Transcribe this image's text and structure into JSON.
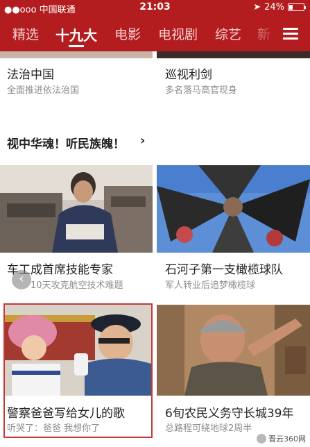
{
  "status_bar": {
    "carrier": "●●ooo 中国联通",
    "wifi_icon": "wifi-icon",
    "time": "21:03",
    "battery_text": "24%",
    "battery_level": 0.24
  },
  "nav": {
    "tabs": [
      {
        "label": "精选",
        "active": false
      },
      {
        "label": "十九大",
        "active": true
      },
      {
        "label": "电影",
        "active": false
      },
      {
        "label": "电视剧",
        "active": false
      },
      {
        "label": "综艺",
        "active": false
      },
      {
        "label": "新",
        "active": false
      }
    ],
    "menu_icon": "hamburger-menu-icon",
    "accent_color": "#b41d1f"
  },
  "top_cards": [
    {
      "title": "法治中国",
      "subtitle": "全面推进依法治国"
    },
    {
      "title": "巡视利剑",
      "subtitle": "多名落马高官现身"
    }
  ],
  "section": {
    "title": "视中华魂！听民族魄！",
    "arrow": "›"
  },
  "cards": [
    {
      "title": "车工成首席技能专家",
      "subtitle": "10天攻克航空技术难题"
    },
    {
      "title": "石河子第一支橄榄球队",
      "subtitle": "军人转业后追梦橄榄球"
    },
    {
      "title": "警察爸爸写给女儿的歌",
      "subtitle": "听哭了：爸爸 我想你了"
    },
    {
      "title": "6旬农民义务守长城39年",
      "subtitle": "总路程可绕地球2周半"
    }
  ],
  "watermark": "晋云360网"
}
